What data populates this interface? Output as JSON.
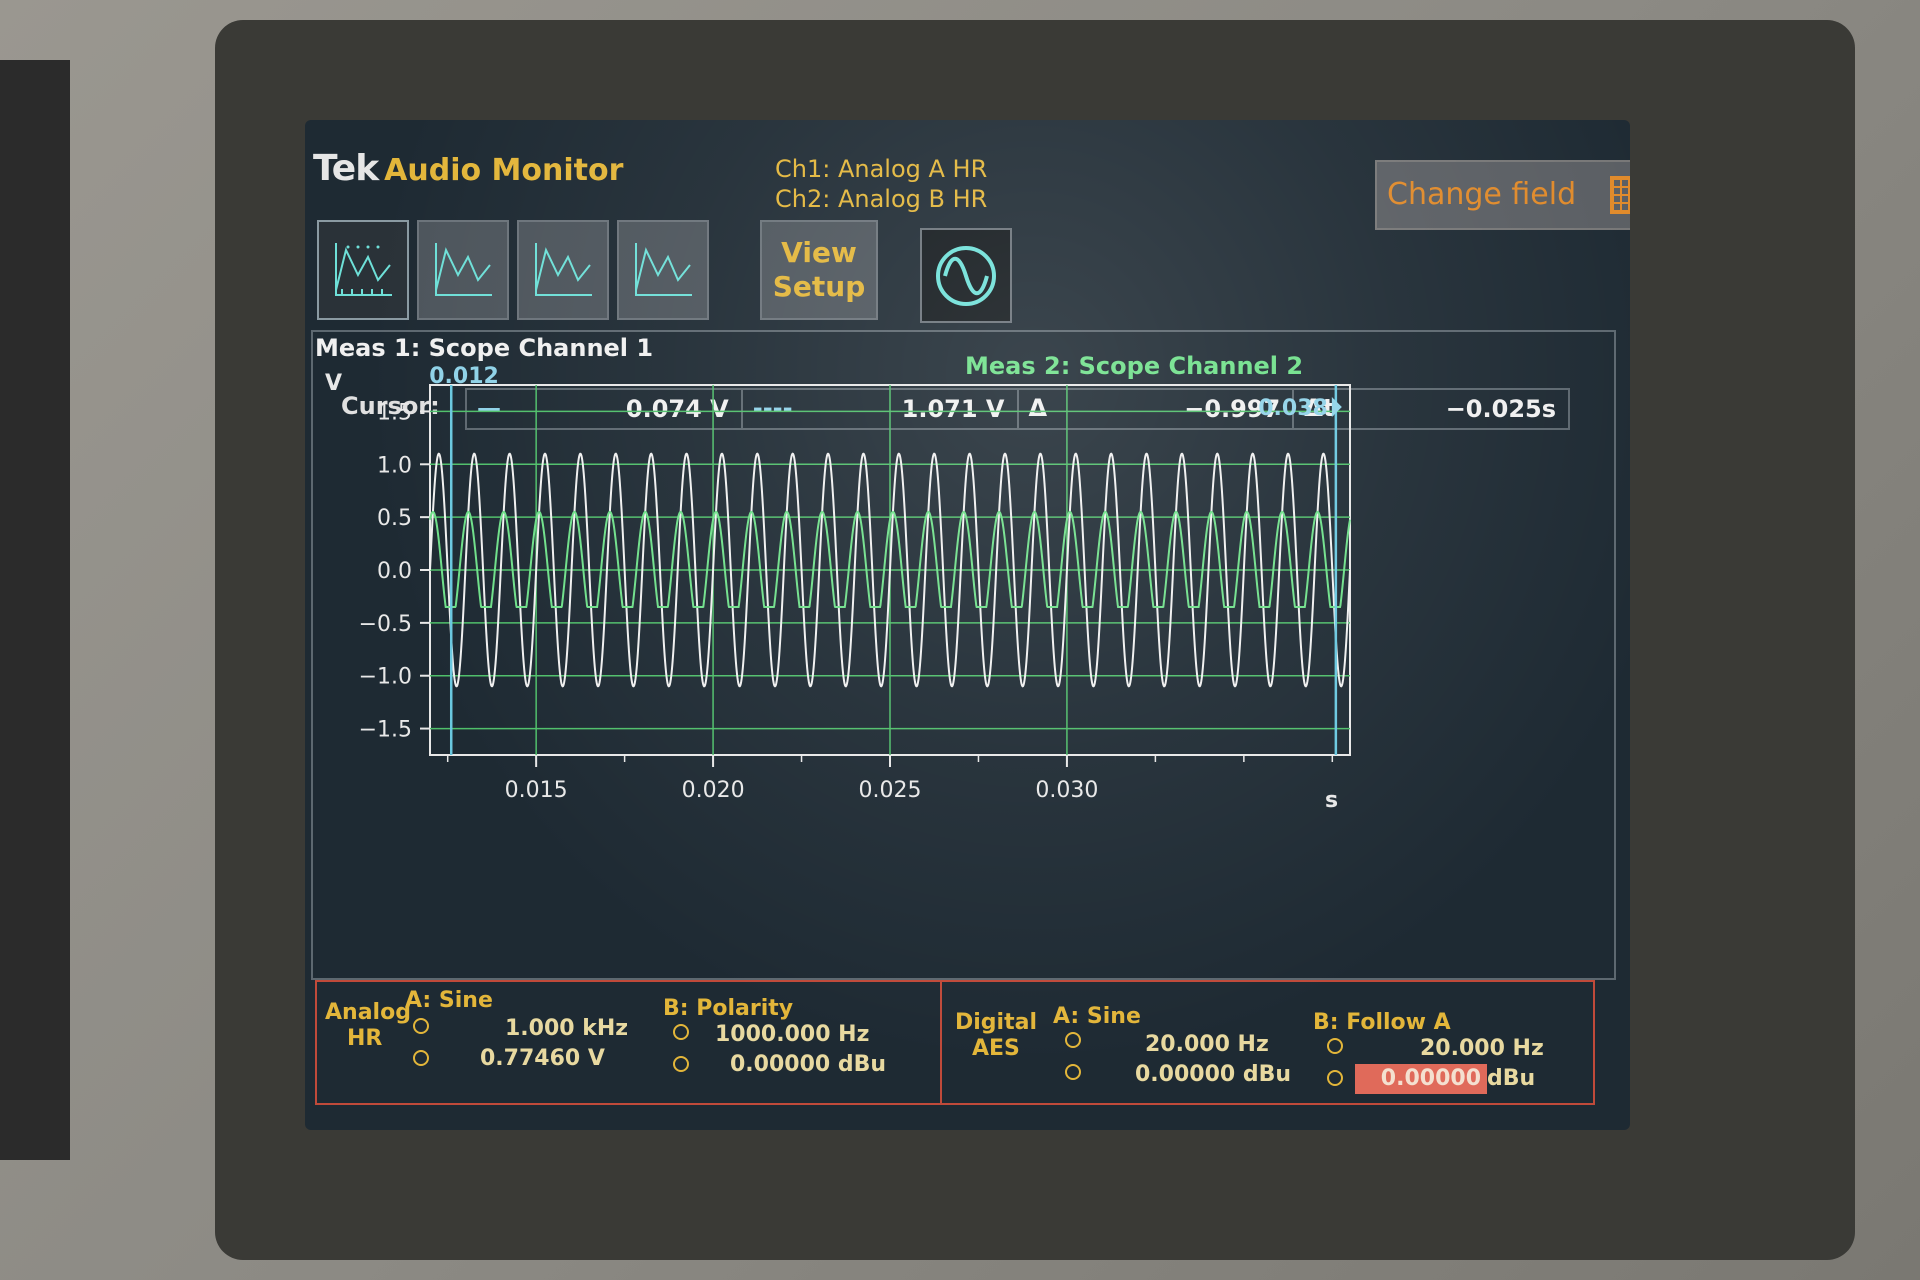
{
  "header": {
    "brand": "Tek",
    "app_name": "Audio Monitor",
    "ch1": "Ch1: Analog A HR",
    "ch2": "Ch2: Analog B HR",
    "change_field": "Change field",
    "view_setup_line1": "View",
    "view_setup_line2": "Setup"
  },
  "measurements": {
    "meas1": "Meas 1: Scope Channel 1",
    "meas2": "Meas 2: Scope Channel 2"
  },
  "cursor": {
    "label": "Cursor:",
    "c1_symbol": "—",
    "c1_value": "0.074 V",
    "c2_symbol": "----",
    "c2_value": "1.071 V",
    "delta_symbol": "Δ",
    "delta_value": "−0.997",
    "dt_symbol": "Δt",
    "dt_value": "−0.025s"
  },
  "chart_data": {
    "type": "line",
    "ylabel": "V",
    "xlabel": "s",
    "ylim": [
      -1.75,
      1.75
    ],
    "xlim": [
      0.012,
      0.038
    ],
    "yticks": [
      "1.5",
      "1.0",
      "0.5",
      "0.0",
      "−0.5",
      "−1.0",
      "−1.5"
    ],
    "ytick_values": [
      1.5,
      1.0,
      0.5,
      0.0,
      -0.5,
      -1.0,
      -1.5
    ],
    "xticks": [
      "0.015",
      "0.020",
      "0.025",
      "0.030"
    ],
    "xtick_values": [
      0.015,
      0.02,
      0.025,
      0.03
    ],
    "cursor_left_label": "0.012",
    "cursor_right_label": "0.038",
    "cursor_left_x": 0.0126,
    "cursor_right_x": 0.0376,
    "cursor_level_1": 0.074,
    "cursor_level_2": 1.071,
    "series": [
      {
        "name": "Scope Channel 1",
        "amplitude": 1.1,
        "frequency_hz": 1000,
        "color": "#f0f0f0"
      },
      {
        "name": "Scope Channel 2",
        "amplitude": 0.55,
        "frequency_hz": 1000,
        "phase_deg": 60,
        "color": "#6fe08a"
      }
    ],
    "grid": true,
    "colors": {
      "grid": "#4fbf6a",
      "axis": "#e8e8e8",
      "cursor": "#6ac8e0",
      "bg": "#1e2a33"
    }
  },
  "generator": {
    "analog_label_1": "Analog",
    "analog_label_2": "HR",
    "a_title": "A: Sine",
    "a_freq": "1.000 kHz",
    "a_level": "0.77460 V",
    "b_title": "B: Polarity",
    "b_freq": "1000.000 Hz",
    "b_level": "0.00000 dBu",
    "digital_label_1": "Digital",
    "digital_label_2": "AES",
    "da_title": "A: Sine",
    "da_freq": "20.000 Hz",
    "da_level": "0.00000 dBu",
    "db_title": "B: Follow A",
    "db_freq": "20.000 Hz",
    "db_level": "0.00000",
    "db_level_unit": "dBu"
  }
}
